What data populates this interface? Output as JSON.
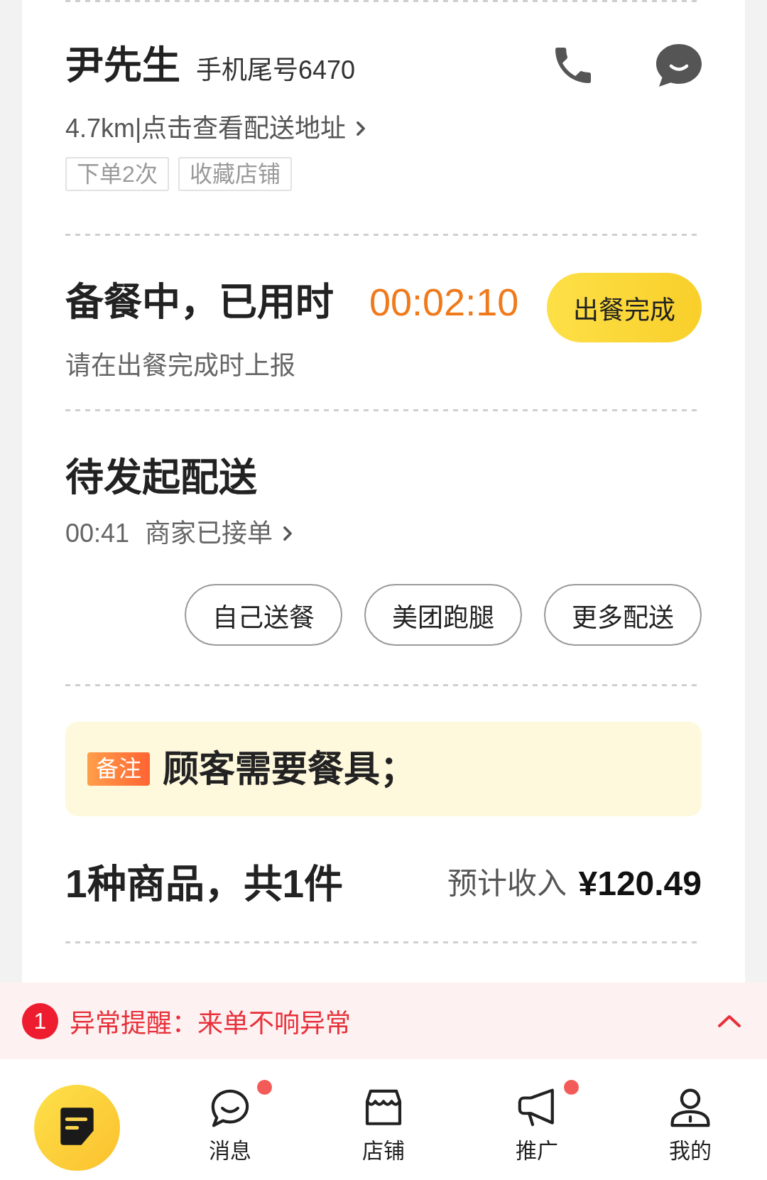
{
  "customer": {
    "name": "尹先生",
    "phone_tail": "手机尾号6470",
    "address_link": "4.7km|点击查看配送地址",
    "tags": [
      "下单2次",
      "收藏店铺"
    ]
  },
  "prep": {
    "status": "备餐中，已用时",
    "timer": "00:02:10",
    "button": "出餐完成",
    "hint": "请在出餐完成时上报"
  },
  "delivery": {
    "title": "待发起配送",
    "time": "00:41",
    "status_link": "商家已接单",
    "buttons": [
      "自己送餐",
      "美团跑腿",
      "更多配送"
    ]
  },
  "remark": {
    "tag": "备注",
    "text": "顾客需要餐具；"
  },
  "summary": {
    "count": "1种商品，共1件",
    "income_label": "预计收入",
    "income": "¥120.49"
  },
  "alert": {
    "count": "1",
    "text": "异常提醒：来单不响异常"
  },
  "tab_bar": {
    "items": [
      {
        "selected": true,
        "badge": false
      },
      {
        "label": "消息",
        "selected": false,
        "badge": true
      },
      {
        "label": "店铺",
        "selected": false,
        "badge": false
      },
      {
        "label": "推广",
        "selected": false,
        "badge": true
      },
      {
        "label": "我的",
        "selected": false,
        "badge": false
      }
    ]
  }
}
